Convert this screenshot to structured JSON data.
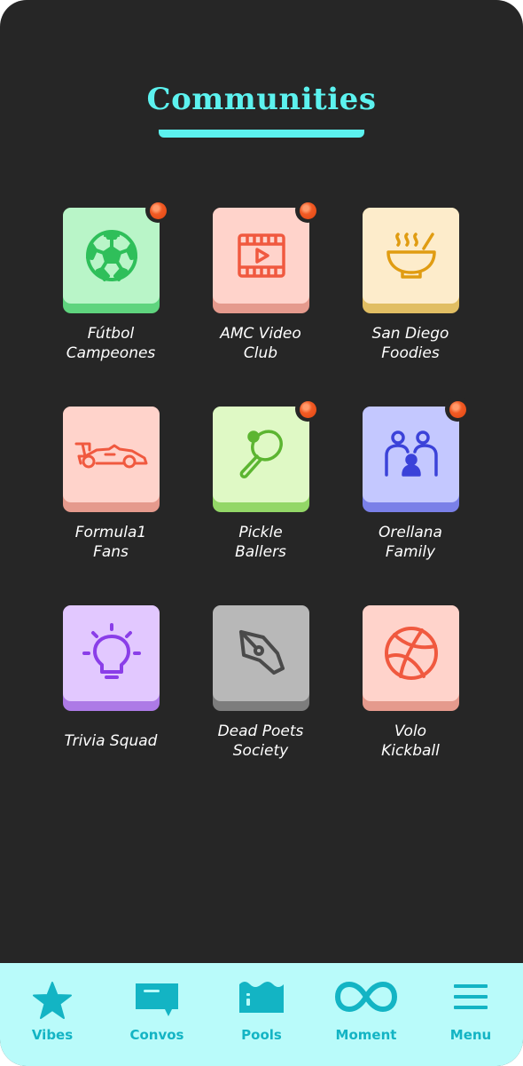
{
  "header": {
    "title": "Communities"
  },
  "communities": [
    {
      "name_line1": "Fútbol",
      "name_line2": "Campeones",
      "icon": "soccer-ball-icon",
      "face": "#b9f5c8",
      "base": "#5fd47e",
      "stroke": "#2fbf5a",
      "notification": true
    },
    {
      "name_line1": "AMC Video",
      "name_line2": "Club",
      "icon": "film-play-icon",
      "face": "#ffd3cb",
      "base": "#e59a8d",
      "stroke": "#f0593f",
      "notification": true
    },
    {
      "name_line1": "San Diego",
      "name_line2": "Foodies",
      "icon": "soup-bowl-icon",
      "face": "#fdeccb",
      "base": "#e1be63",
      "stroke": "#e09c12",
      "notification": false
    },
    {
      "name_line1": "Formula1",
      "name_line2": "Fans",
      "icon": "race-car-icon",
      "face": "#ffd3cb",
      "base": "#e59a8d",
      "stroke": "#f0593f",
      "notification": false
    },
    {
      "name_line1": "Pickle",
      "name_line2": "Ballers",
      "icon": "paddle-ball-icon",
      "face": "#dff9c5",
      "base": "#93d767",
      "stroke": "#5cb531",
      "notification": true
    },
    {
      "name_line1": "Orellana",
      "name_line2": "Family",
      "icon": "family-icon",
      "face": "#c4c8ff",
      "base": "#7a80e8",
      "stroke": "#3b42d9",
      "notification": true
    },
    {
      "name_line1": "Trivia Squad",
      "name_line2": "",
      "icon": "lightbulb-icon",
      "face": "#e2c8ff",
      "base": "#ad7ae6",
      "stroke": "#8a3ee8",
      "notification": false
    },
    {
      "name_line1": "Dead Poets",
      "name_line2": "Society",
      "icon": "pen-nib-icon",
      "face": "#b8b8b8",
      "base": "#7d7d7d",
      "stroke": "#4a4a4a",
      "notification": false
    },
    {
      "name_line1": "Volo",
      "name_line2": "Kickball",
      "icon": "ball-icon",
      "face": "#ffd3cb",
      "base": "#e59a8d",
      "stroke": "#f0593f",
      "notification": false
    }
  ],
  "nav": {
    "items": [
      {
        "label": "Vibes",
        "icon": "star-icon"
      },
      {
        "label": "Convos",
        "icon": "chat-bubble-icon"
      },
      {
        "label": "Pools",
        "icon": "pool-icon"
      },
      {
        "label": "Moment",
        "icon": "infinity-icon"
      },
      {
        "label": "Menu",
        "icon": "hamburger-menu-icon"
      }
    ],
    "color": "#13b4c4",
    "background": "#b9fbfa"
  }
}
